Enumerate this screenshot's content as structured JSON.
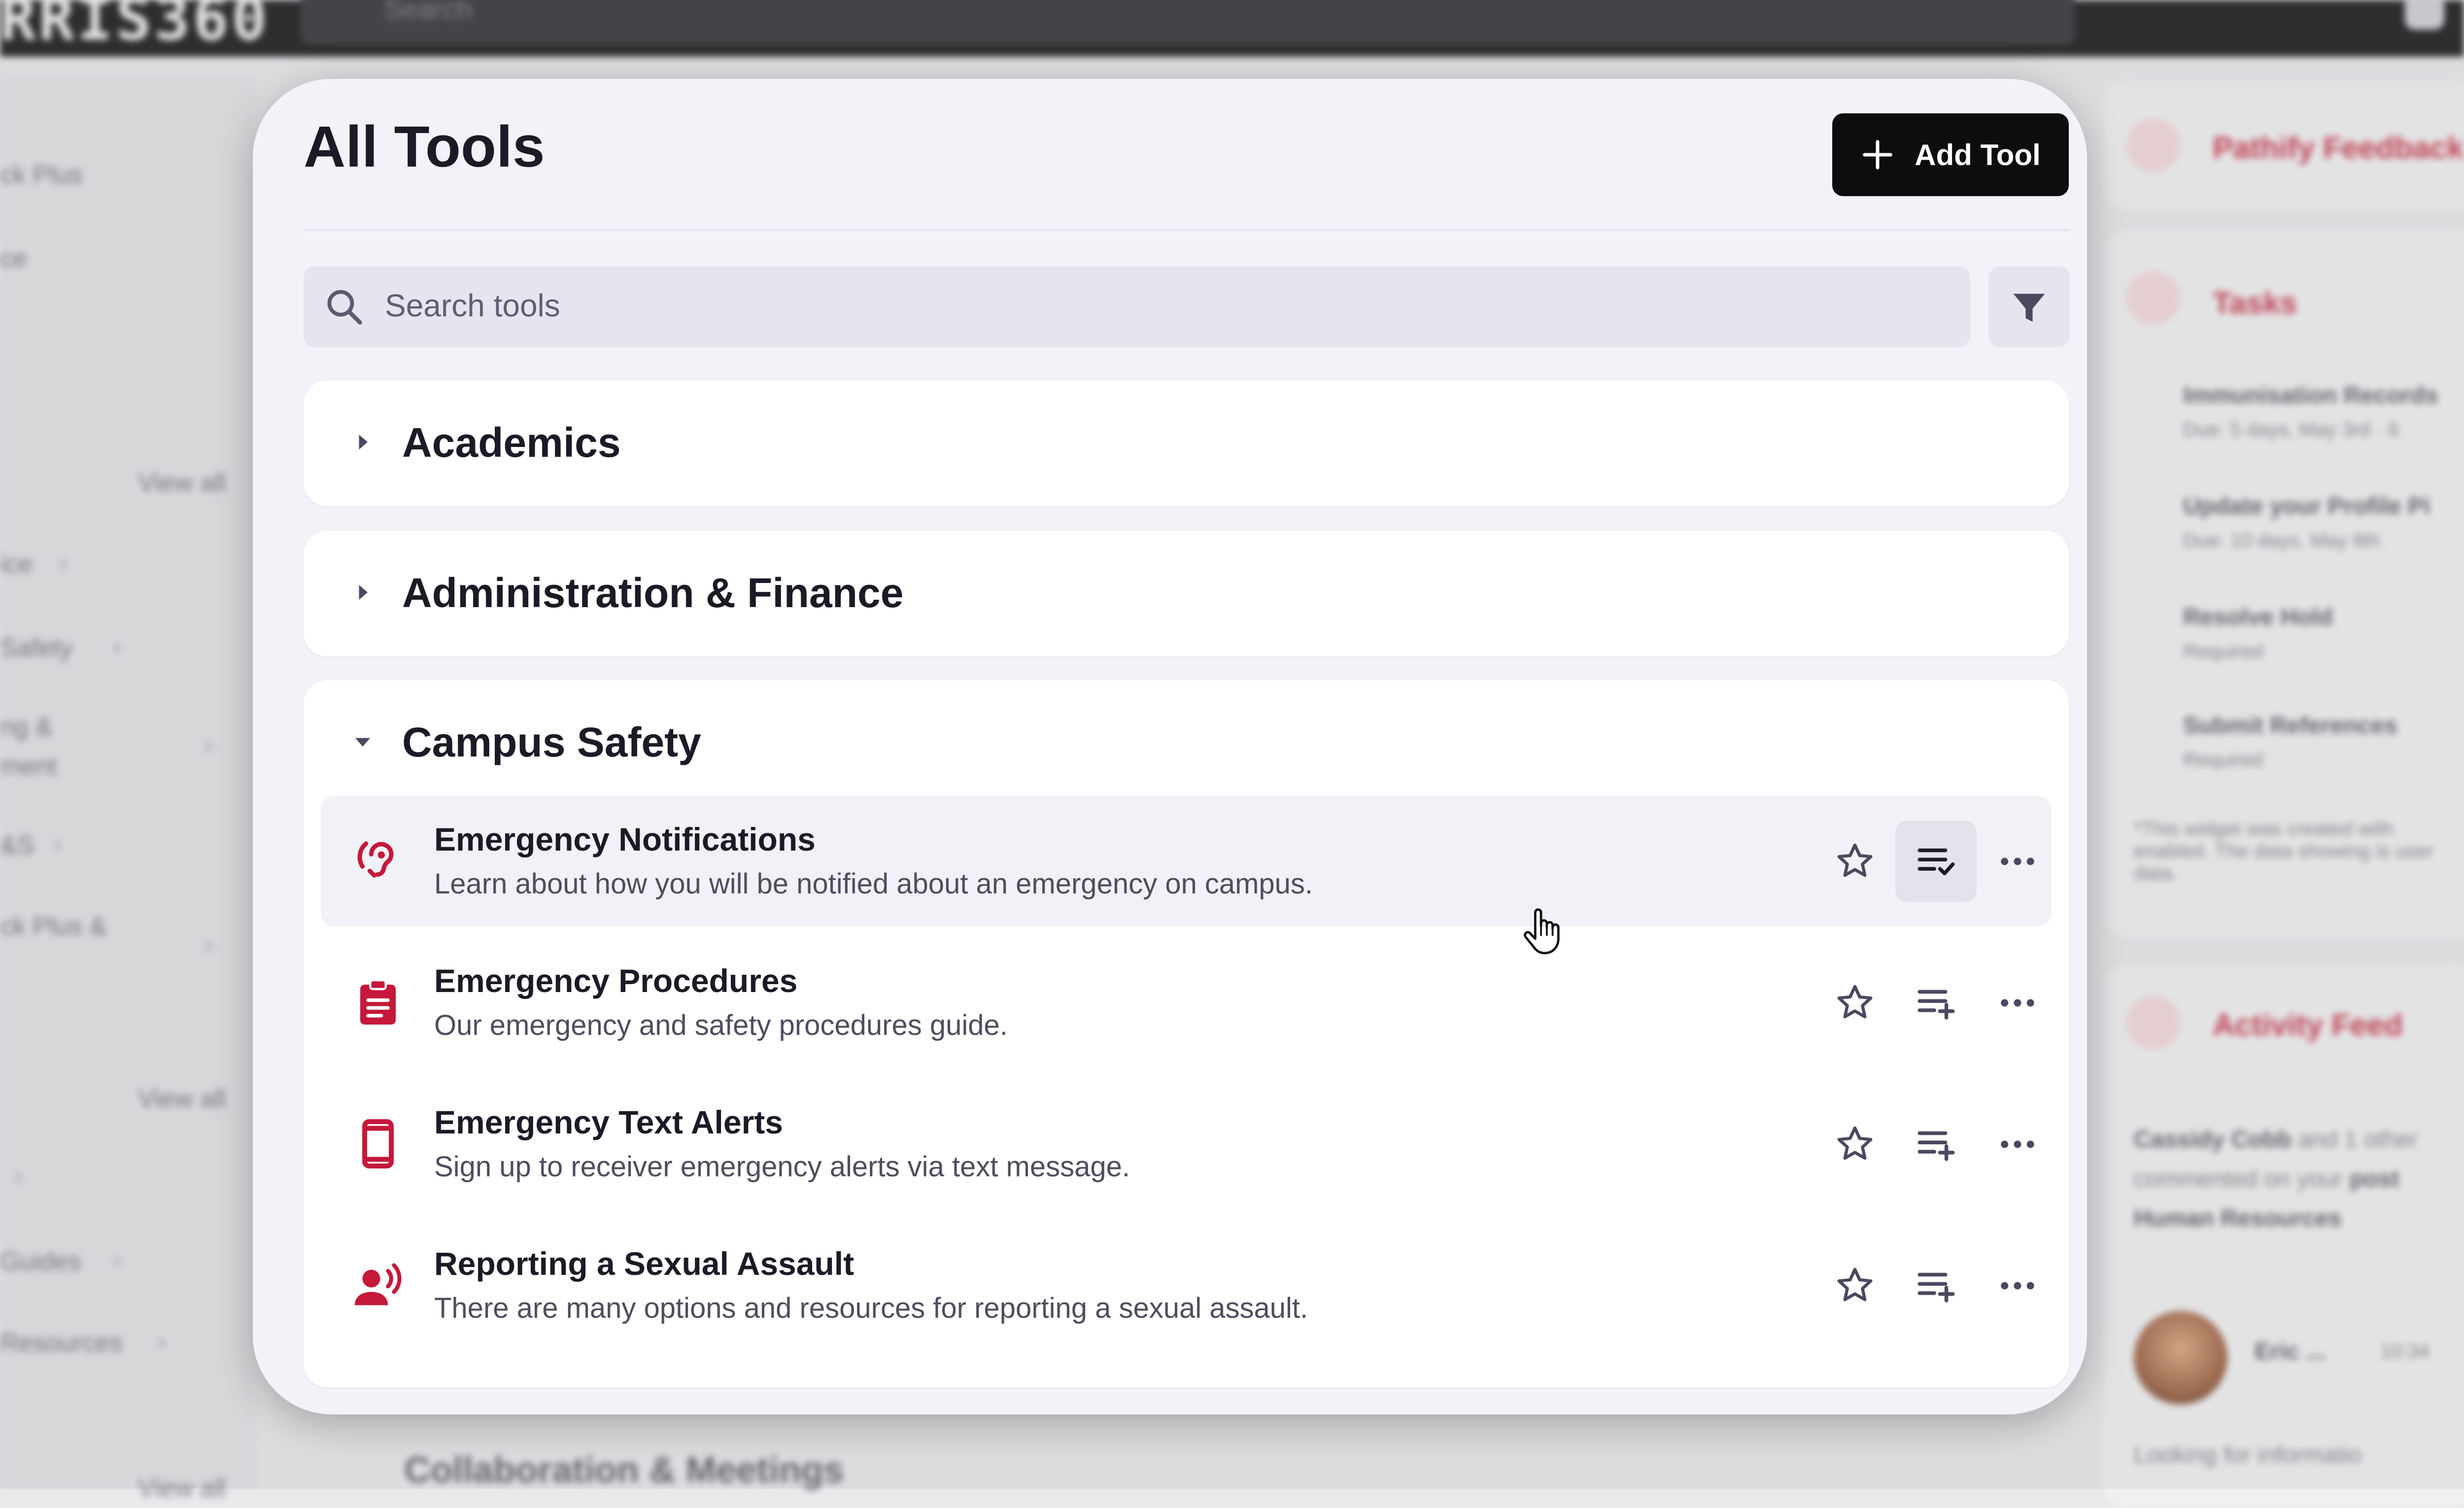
{
  "background": {
    "brand": "RRIS360",
    "search_placeholder": "Search",
    "left_nav": [
      {
        "label": "ck Plus",
        "chevron": false
      },
      {
        "label": "ce",
        "chevron": false
      },
      {
        "label": "View all",
        "chevron": false
      },
      {
        "label": "ice",
        "chevron": true
      },
      {
        "label": "Safety",
        "chevron": true
      },
      {
        "label": "ng &",
        "chevron": false
      },
      {
        "label": "ment",
        "chevron": true
      },
      {
        "label": "&S",
        "chevron": true
      },
      {
        "label": "ck Plus &",
        "chevron": false
      },
      {
        "label": "View all",
        "chevron": false
      },
      {
        "label": "Guides",
        "chevron": true
      },
      {
        "label": "Resources",
        "chevron": true
      },
      {
        "label": "View all",
        "chevron": false
      }
    ],
    "right_cards": {
      "feedback_title": "Pathify Feedback",
      "tasks_title": "Tasks",
      "tasks": [
        {
          "title": "Immunisation Records",
          "sub": "Due: 5 days, May 3rd · 6"
        },
        {
          "title": "Update your Profile Pi",
          "sub": "Due: 10 days, May 8th"
        },
        {
          "title": "Resolve Hold",
          "sub": "Required"
        },
        {
          "title": "Submit References",
          "sub": "Required"
        }
      ],
      "widget_note": "*This widget was created with enabled. The data showing is user data.",
      "activity_title": "Activity Feed",
      "activity_text_1": "Cassidy Cobb",
      "activity_text_2": " and 1 other",
      "activity_text_3": "commented on your ",
      "activity_text_4": "post",
      "activity_text_5": "Human Resources",
      "person_name": "Eric ...",
      "person_time": "10:34",
      "person_text": "Looking for informatio"
    },
    "below_section": "Collaboration & Meetings"
  },
  "modal": {
    "title": "All Tools",
    "add_button": "Add Tool",
    "search_placeholder": "Search tools",
    "sections": [
      {
        "title": "Academics",
        "expanded": false
      },
      {
        "title": "Administration & Finance",
        "expanded": false
      },
      {
        "title": "Campus Safety",
        "expanded": true
      }
    ],
    "tools": [
      {
        "name": "Emergency Notifications",
        "desc": "Learn about how you will be notified about an emergency on campus.",
        "icon": "hearing-icon",
        "in_list": true
      },
      {
        "name": "Emergency Procedures",
        "desc": "Our emergency and safety procedures guide.",
        "icon": "clipboard-icon",
        "in_list": false
      },
      {
        "name": "Emergency Text Alerts",
        "desc": "Sign up to receiver emergency alerts via text message.",
        "icon": "phone-icon",
        "in_list": false
      },
      {
        "name": "Reporting a Sexual Assault",
        "desc": "There are many options and resources for reporting a sexual assault.",
        "icon": "speaking-person-icon",
        "in_list": false
      }
    ],
    "colors": {
      "accent": "#c5183a",
      "button": "#0d0d10",
      "icon_gray": "#5c5a6e"
    }
  }
}
